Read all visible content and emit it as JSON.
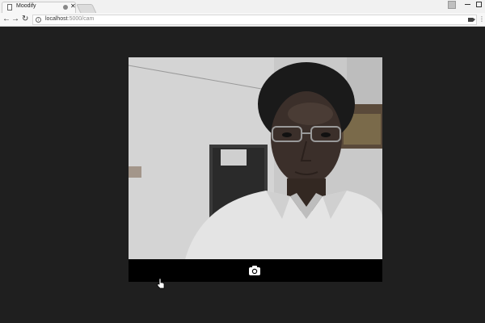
{
  "browser": {
    "tab": {
      "title": "Moodify"
    },
    "address_bar": {
      "host": "localhost",
      "path": ":5000/cam"
    },
    "icons": {
      "page": "document-icon",
      "back": "back-arrow-icon",
      "forward": "forward-arrow-icon",
      "reload": "reload-icon",
      "site_info": "info-icon",
      "camera_in_use": "camera-indicator-icon",
      "bookmark": "star-icon",
      "menu": "more-vert-icon"
    }
  },
  "webcam": {
    "capture_icon": "camera-icon"
  },
  "colors": {
    "page_background": "#1f1f1f",
    "control_bar": "#000000",
    "chrome": "#f1f1f1"
  }
}
